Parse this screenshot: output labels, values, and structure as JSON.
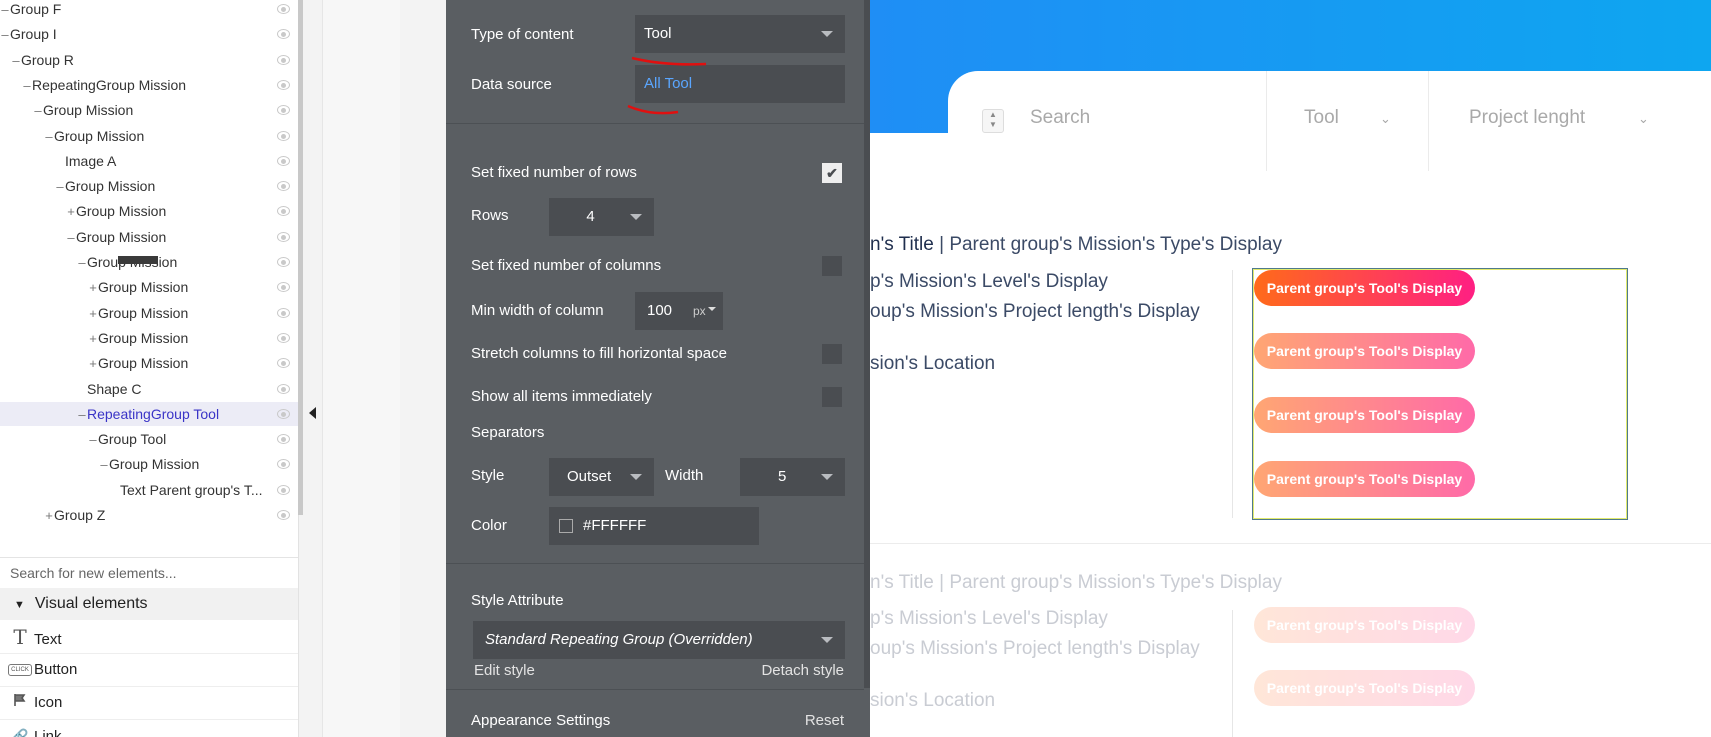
{
  "tree": {
    "items": [
      {
        "label": "Group F",
        "toggle": "-",
        "indent": 0
      },
      {
        "label": "Group I",
        "toggle": "-",
        "indent": 0
      },
      {
        "label": "Group R",
        "toggle": "-",
        "indent": 1
      },
      {
        "label": "RepeatingGroup Mission",
        "toggle": "-",
        "indent": 2
      },
      {
        "label": "Group Mission",
        "toggle": "-",
        "indent": 3
      },
      {
        "label": "Group Mission",
        "toggle": "-",
        "indent": 4
      },
      {
        "label": "Image A",
        "toggle": "",
        "indent": 5
      },
      {
        "label": "Group Mission",
        "toggle": "-",
        "indent": 5
      },
      {
        "label": "Group Mission",
        "toggle": "+",
        "indent": 6
      },
      {
        "label": "Group Mission",
        "toggle": "-",
        "indent": 6
      },
      {
        "label": "Group Mission",
        "toggle": "-",
        "indent": 7
      },
      {
        "label": "Group Mission",
        "toggle": "+",
        "indent": 8
      },
      {
        "label": "Group Mission",
        "toggle": "+",
        "indent": 8
      },
      {
        "label": "Group Mission",
        "toggle": "+",
        "indent": 8
      },
      {
        "label": "Group Mission",
        "toggle": "+",
        "indent": 8
      },
      {
        "label": "Shape C",
        "toggle": "",
        "indent": 7
      },
      {
        "label": "RepeatingGroup Tool",
        "toggle": "-",
        "indent": 7,
        "selected": true
      },
      {
        "label": "Group Tool",
        "toggle": "-",
        "indent": 8
      },
      {
        "label": "Group Mission",
        "toggle": "-",
        "indent": 9
      },
      {
        "label": "Text Parent group's T...",
        "toggle": "",
        "indent": 10
      },
      {
        "label": "Group Z",
        "toggle": "+",
        "indent": 4
      }
    ],
    "search_placeholder": "Search for new elements...",
    "section_title": "Visual elements",
    "elements": [
      {
        "label": "Text",
        "icon": "text-icon"
      },
      {
        "label": "Button",
        "icon": "button-icon"
      },
      {
        "label": "Icon",
        "icon": "flag-icon"
      },
      {
        "label": "Link",
        "icon": "link-icon"
      }
    ]
  },
  "editor": {
    "type_of_content_label": "Type of content",
    "type_of_content_value": "Tool",
    "data_source_label": "Data source",
    "data_source_value": "All Tool",
    "fixed_rows_label": "Set fixed number of rows",
    "fixed_rows_checked": true,
    "rows_label": "Rows",
    "rows_value": "4",
    "fixed_columns_label": "Set fixed number of columns",
    "min_width_label": "Min width of column",
    "min_width_value": "100",
    "min_width_unit": "px",
    "stretch_label": "Stretch columns to fill horizontal space",
    "show_all_label": "Show all items immediately",
    "separators_label": "Separators",
    "style_label": "Style",
    "style_value": "Outset",
    "width_label": "Width",
    "width_value": "5",
    "color_label": "Color",
    "color_value": "#FFFFFF",
    "style_attribute_label": "Style Attribute",
    "style_attribute_value": "Standard Repeating Group (Overridden)",
    "edit_style": "Edit style",
    "detach_style": "Detach style",
    "appearance_label": "Appearance Settings",
    "reset_label": "Reset"
  },
  "canvas": {
    "search_placeholder": "Search",
    "filter_tool": "Tool",
    "filter_project": "Project lenght",
    "card1": {
      "title_bold": "n's Title",
      "title_rest": " | Parent group's Mission's Type's Display",
      "level": "p's Mission's Level's Display",
      "project_length": "oup's Mission's Project length's Display",
      "location": "sion's Location"
    },
    "card2": {
      "title_bold": "n's Title",
      "title_rest": " | Parent group's Mission's Type's Display",
      "level": "p's Mission's Level's Display",
      "project_length": "oup's Mission's Project length's Display",
      "location": "sion's Location"
    },
    "tool_pill_text": "Parent group's Tool's Display"
  },
  "colors": {
    "editor_bg": "#5a5e62",
    "field_bg": "#4a4d51",
    "link": "#5aa6ff",
    "selected_tree_text": "#3a34c7",
    "pill_gradient_start": "#ff6a1a",
    "pill_gradient_end": "#ff1f83",
    "header_blue": "#1f8ef5"
  }
}
